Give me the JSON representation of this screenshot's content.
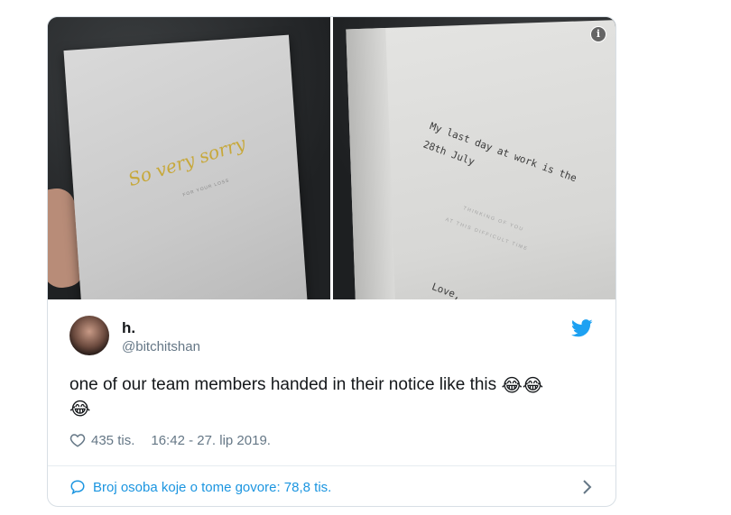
{
  "tweet": {
    "media": {
      "left_card": {
        "title": "So very sorry",
        "subtitle": "FOR YOUR LOSS"
      },
      "right_card": {
        "handwritten_line1": "My last day at work is the",
        "handwritten_line2": "28th July",
        "printed_line1": "THINKING OF YOU",
        "printed_line2": "AT THIS DIFFICULT TIME",
        "signoff": "Love,"
      },
      "info_icon": "info-icon"
    },
    "author": {
      "name": "h.",
      "handle": "@bitchitshan"
    },
    "text": "one of our team members handed in their notice like this",
    "emoji_inline": "😂😂",
    "emoji_newline": "😂",
    "likes": "435 tis.",
    "timestamp": "16:42 - 27. lip 2019.",
    "conversation": "Broj osoba koje o tome govore: 78,8 tis.",
    "colors": {
      "link": "#1b95e0",
      "muted": "#657786",
      "text": "#14171a",
      "border": "#d8dfe5"
    },
    "icons": [
      "info-icon",
      "twitter-bird-icon",
      "heart-icon",
      "comment-icon",
      "chevron-right-icon"
    ]
  }
}
